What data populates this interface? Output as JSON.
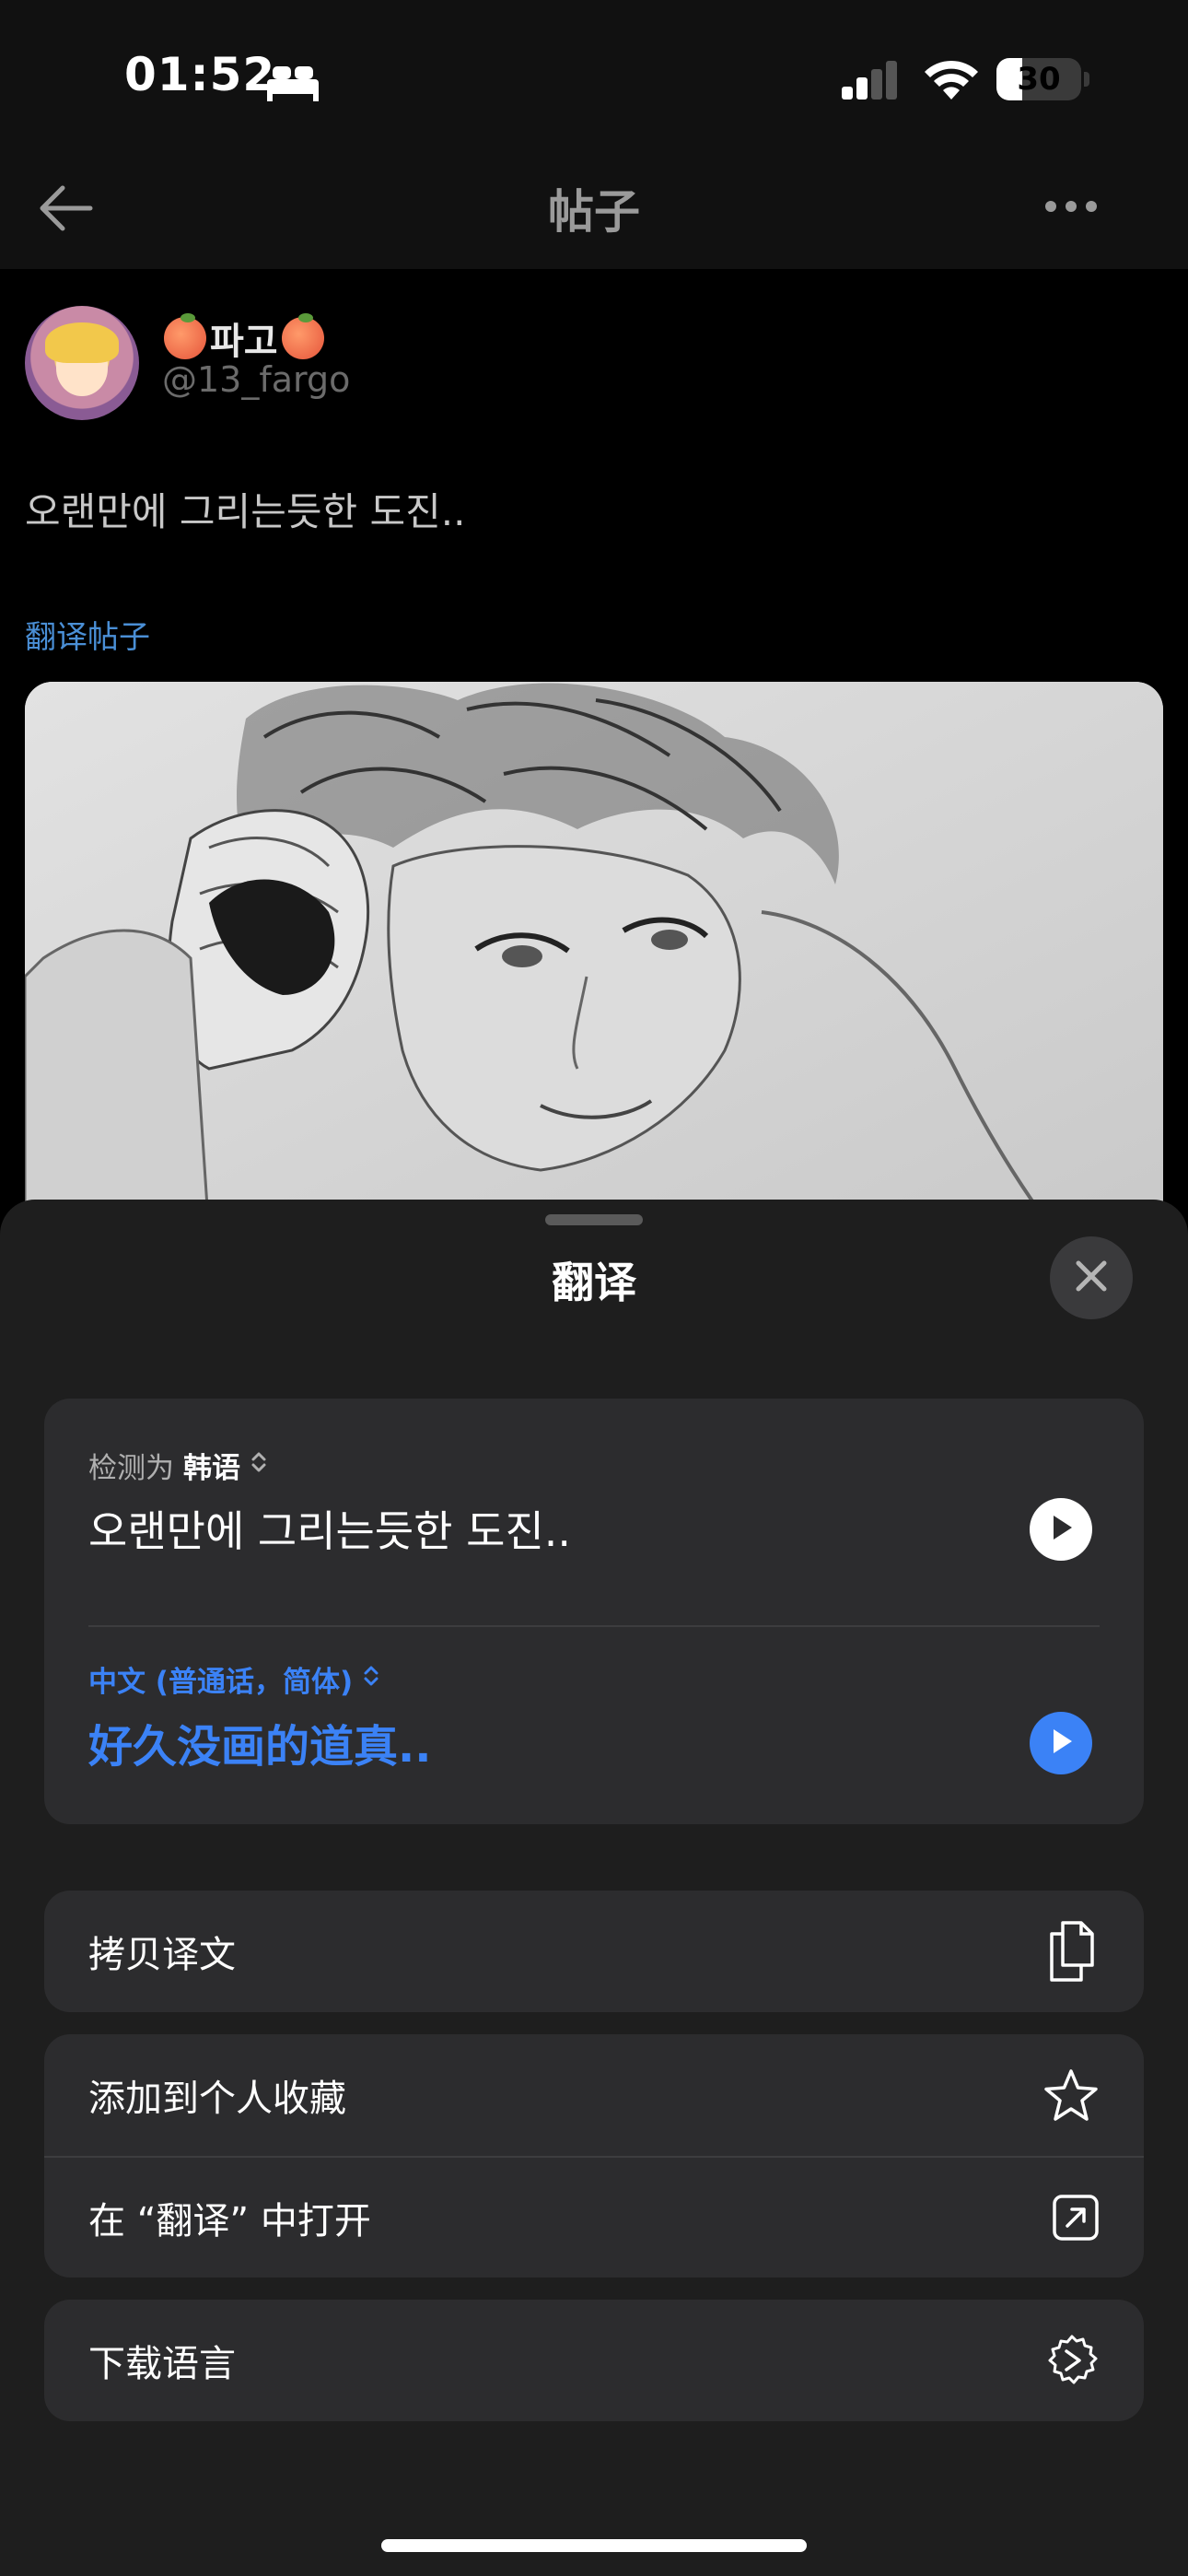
{
  "status_bar": {
    "time": "01:52",
    "battery": "30",
    "battery_level": 0.3
  },
  "nav": {
    "title": "帖子"
  },
  "post": {
    "display_name": "파고",
    "handle": "@13_fargo",
    "text": "오랜만에 그리는듯한 도진..",
    "translate_link": "翻译帖子"
  },
  "sheet": {
    "title": "翻译",
    "detect_prefix": "检测为",
    "detected_language": "韩语",
    "source_text": "오랜만에 그리는듯한 도진..",
    "target_language": "中文 (普通话，简体)",
    "translated_text": "好久没画的道真..",
    "actions": [
      {
        "label": "拷贝译文",
        "icon": "copy-icon"
      },
      {
        "label": "添加到个人收藏",
        "icon": "star-icon"
      },
      {
        "label": "在 “翻译” 中打开",
        "icon": "open-external-icon"
      },
      {
        "label": "下载语言",
        "icon": "download-language-icon"
      }
    ]
  },
  "colors": {
    "accent": "#3b82f6",
    "link": "#4a8fd6",
    "card": "#2c2c2e",
    "sheet": "#1e1e1e"
  }
}
